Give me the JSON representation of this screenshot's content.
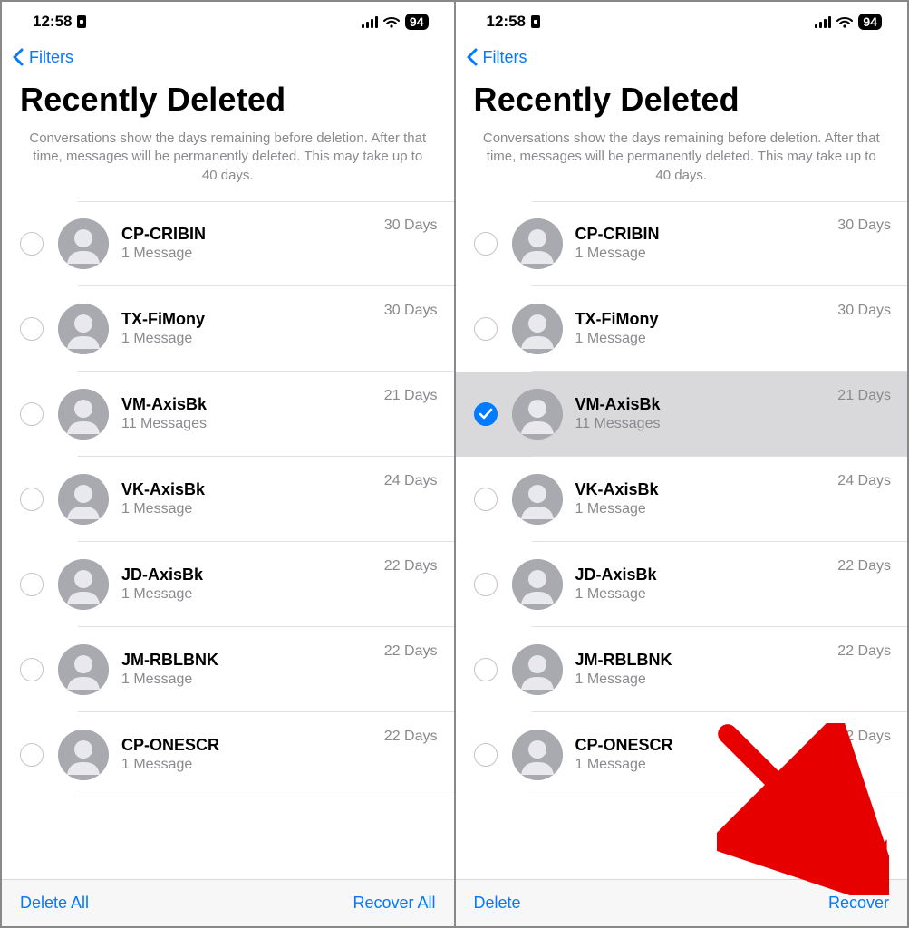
{
  "status": {
    "time": "12:58",
    "battery": "94"
  },
  "nav": {
    "back": "Filters",
    "title": "Recently Deleted",
    "subtitle": "Conversations show the days remaining before deletion. After that time, messages will be permanently deleted. This may take up to 40 days."
  },
  "screens": [
    {
      "toolbar_left": "Delete All",
      "toolbar_right": "Recover All",
      "rows": [
        {
          "name": "CP-CRIBIN",
          "sub": "1 Message",
          "days": "30 Days",
          "selected": false
        },
        {
          "name": "TX-FiMony",
          "sub": "1 Message",
          "days": "30 Days",
          "selected": false
        },
        {
          "name": "VM-AxisBk",
          "sub": "11 Messages",
          "days": "21 Days",
          "selected": false
        },
        {
          "name": "VK-AxisBk",
          "sub": "1 Message",
          "days": "24 Days",
          "selected": false
        },
        {
          "name": "JD-AxisBk",
          "sub": "1 Message",
          "days": "22 Days",
          "selected": false
        },
        {
          "name": "JM-RBLBNK",
          "sub": "1 Message",
          "days": "22 Days",
          "selected": false
        },
        {
          "name": "CP-ONESCR",
          "sub": "1 Message",
          "days": "22 Days",
          "selected": false
        }
      ],
      "arrow": false
    },
    {
      "toolbar_left": "Delete",
      "toolbar_right": "Recover",
      "rows": [
        {
          "name": "CP-CRIBIN",
          "sub": "1 Message",
          "days": "30 Days",
          "selected": false
        },
        {
          "name": "TX-FiMony",
          "sub": "1 Message",
          "days": "30 Days",
          "selected": false
        },
        {
          "name": "VM-AxisBk",
          "sub": "11 Messages",
          "days": "21 Days",
          "selected": true
        },
        {
          "name": "VK-AxisBk",
          "sub": "1 Message",
          "days": "24 Days",
          "selected": false
        },
        {
          "name": "JD-AxisBk",
          "sub": "1 Message",
          "days": "22 Days",
          "selected": false
        },
        {
          "name": "JM-RBLBNK",
          "sub": "1 Message",
          "days": "22 Days",
          "selected": false
        },
        {
          "name": "CP-ONESCR",
          "sub": "1 Message",
          "days": "22 Days",
          "selected": false
        }
      ],
      "arrow": true
    }
  ]
}
